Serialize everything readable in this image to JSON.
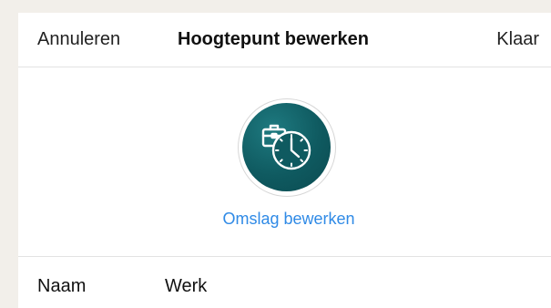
{
  "nav": {
    "cancel_label": "Annuleren",
    "title": "Hoogtepunt bewerken",
    "done_label": "Klaar"
  },
  "cover": {
    "icon": "briefcase-clock-icon",
    "edit_label": "Omslag bewerken",
    "circle_color": "#0f5a60"
  },
  "name_row": {
    "label": "Naam",
    "value": "Werk"
  },
  "colors": {
    "background": "#f2efea",
    "link": "#2f8ae6"
  }
}
